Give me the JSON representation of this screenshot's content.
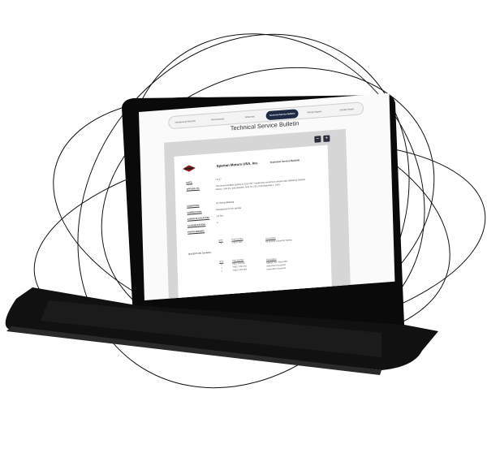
{
  "nav": {
    "tabs": [
      {
        "label": "Maintenance Records",
        "active": false
      },
      {
        "label": "Fleet Manuals",
        "active": false
      },
      {
        "label": "Schematic",
        "active": false
      },
      {
        "label": "Technical Service Bulletin",
        "active": true
      },
      {
        "label": "Wiring Diagram",
        "active": false
      },
      {
        "label": "Activate Master",
        "active": false
      }
    ]
  },
  "page": {
    "title": "Technical Service Bulletin"
  },
  "toolbar": {
    "zoom_out": "−",
    "zoom_in": "+"
  },
  "document": {
    "company": "Spartan Motors USA, Inc.",
    "doc_type": "Technical Service Bulletin",
    "fields": {
      "date_label": "DATE:",
      "date_value": "2-9-17",
      "applies_label": "APPLIES TO:",
      "applies_value": "This service bulletin applies to 2011-2017 model year transit bus chassis cabs altered by Spartan Motors, USA Inc. built between June 18, 2011 and December 1, 2016.",
      "condition_label": "CONDITION:",
      "condition_value": "Air Spring Bleeding",
      "correction_label": "CORRECTION:",
      "correction_value": "Replacement of air springs",
      "labor_label": "LABOR ALLOCATION:",
      "labor_value": "1.0 Hrs.",
      "classification_label": "CLASSIFICATION:",
      "classification_value": "V",
      "parts_label": "PARTS NEEDED:"
    },
    "parts_table_1": {
      "qty_header": "QTY",
      "part_header": "Part Number",
      "desc_header": "Description",
      "rows": [
        {
          "qty": "1",
          "part": "1-2577-001",
          "desc": "Kit Service, Dbced Air Spring"
        }
      ]
    },
    "kit_label": "(K)1-2577-001 Contains:",
    "parts_table_2": {
      "qty_header": "QTY",
      "part_header": "Part Number",
      "desc_header": "Description",
      "rows": [
        {
          "qty": "2",
          "part": "0461-152-001",
          "desc": "Springs, Air, Dbced IFS"
        },
        {
          "qty": "1",
          "part": "TSB17-250-001",
          "desc": "Instruction Document"
        },
        {
          "qty": "1",
          "part": "TSB17-250-001",
          "desc": "Instruction Document"
        }
      ]
    }
  }
}
